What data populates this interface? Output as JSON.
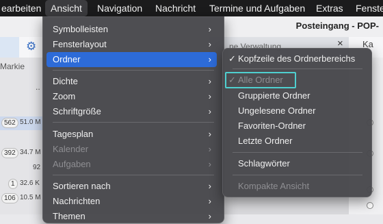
{
  "menubar": {
    "items": [
      "earbeiten",
      "Ansicht",
      "Navigation",
      "Nachricht",
      "Termine und Aufgaben",
      "Extras",
      "Fenste"
    ],
    "active_index": 1
  },
  "app": {
    "title": "Posteingang - POP-",
    "tab_label": "ne Verwaltung",
    "tab_close": "×",
    "right_tab": "Ka",
    "markieren": "Markie",
    "dots": "..",
    "rows": [
      {
        "count": "562",
        "size": "51.0 M"
      },
      {
        "count": "392",
        "size": "34.7 M"
      },
      {
        "count": "",
        "size": "92"
      },
      {
        "count": "1",
        "size": "32.6 K"
      },
      {
        "count": "106",
        "size": "10.5 M"
      }
    ]
  },
  "ansicht_menu": {
    "items": [
      {
        "label": "Symbolleisten",
        "submenu": true
      },
      {
        "label": "Fensterlayout",
        "submenu": true
      },
      {
        "label": "Ordner",
        "submenu": true,
        "highlighted": true
      },
      {
        "label": "Dichte",
        "submenu": true
      },
      {
        "label": "Zoom",
        "submenu": true
      },
      {
        "label": "Schriftgröße",
        "submenu": true
      },
      {
        "label": "Tagesplan",
        "submenu": true
      },
      {
        "label": "Kalender",
        "submenu": true,
        "disabled": true
      },
      {
        "label": "Aufgaben",
        "submenu": true,
        "disabled": true
      },
      {
        "label": "Sortieren nach",
        "submenu": true
      },
      {
        "label": "Nachrichten",
        "submenu": true
      },
      {
        "label": "Themen",
        "submenu": true
      }
    ]
  },
  "ordner_menu": {
    "items": [
      {
        "label": "Kopfzeile des Ordnerbereichs",
        "checked": true
      },
      {
        "label": "Alle Ordner",
        "checked": true,
        "disabled": true,
        "focused": true
      },
      {
        "label": "Gruppierte Ordner"
      },
      {
        "label": "Ungelesene Ordner"
      },
      {
        "label": "Favoriten-Ordner"
      },
      {
        "label": "Letzte Ordner"
      },
      {
        "label": "Schlagwörter"
      },
      {
        "label": "Kompakte Ansicht",
        "disabled": true
      }
    ]
  },
  "glyphs": {
    "chevron": "›",
    "check": "✓",
    "gear": "⚙"
  },
  "colors": {
    "highlight": "#2d6bd8",
    "focus_ring": "#4fd0d0",
    "menubar": "#1b1b1c"
  }
}
